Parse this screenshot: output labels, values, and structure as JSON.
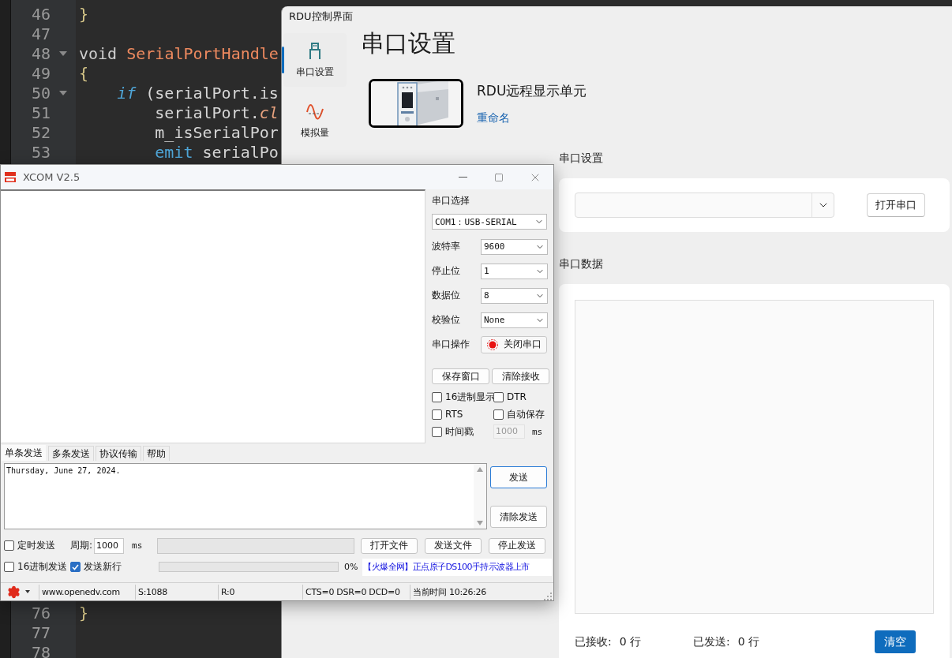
{
  "editor": {
    "lines_top": [
      {
        "number": "46",
        "fold": false,
        "tokens": [
          {
            "text": "}",
            "kind": "brace"
          }
        ]
      },
      {
        "number": "47",
        "fold": false
      },
      {
        "number": "48",
        "fold": true,
        "tokens": [
          {
            "text": "void",
            "kind": "type"
          },
          {
            "text": " SerialPortHandle",
            "kind": "function"
          }
        ]
      },
      {
        "number": "49",
        "fold": false,
        "tokens": [
          {
            "text": "{",
            "kind": "brace"
          }
        ]
      },
      {
        "number": "50",
        "fold": true,
        "tokens": [
          {
            "text": "    if",
            "kind": "keyword"
          },
          {
            "text": " (serialPort.is",
            "kind": "plain"
          }
        ]
      },
      {
        "number": "51",
        "fold": false,
        "tokens": [
          {
            "text": "        serialPort.",
            "kind": "plain"
          },
          {
            "text": "cl",
            "kind": "method"
          }
        ]
      },
      {
        "number": "52",
        "fold": false,
        "tokens": [
          {
            "text": "        m_isSerialPor",
            "kind": "plain"
          }
        ]
      },
      {
        "number": "53",
        "fold": false,
        "tokens": [
          {
            "text": "        emit",
            "kind": "keyword"
          },
          {
            "text": " serialPo",
            "kind": "plain"
          }
        ]
      }
    ],
    "lines_bottom": [
      {
        "number": "76",
        "fold": false,
        "tokens": [
          {
            "text": "}",
            "kind": "brace"
          }
        ]
      },
      {
        "number": "77",
        "fold": false
      },
      {
        "number": "78",
        "fold": false
      }
    ]
  },
  "rdu_window": {
    "title": "RDU控制界面",
    "nav": [
      {
        "label": "串口设置",
        "kind": "port",
        "selected": true
      },
      {
        "label": "模拟量",
        "kind": "wave",
        "selected": false
      }
    ],
    "heading": "串口设置",
    "device": {
      "kind": "picture",
      "name": "RDU远程显示单元",
      "rename_link": "重命名"
    },
    "port_section": {
      "label": "串口设置",
      "button": "打开串口"
    },
    "data_section": {
      "label": "串口数据",
      "received_label": "已接收:",
      "received": "0 行",
      "sent_label": "已发送:",
      "sent": "0 行",
      "clear_button": "清空"
    }
  },
  "xcom": {
    "title": "XCOM V2.5",
    "port_label": "串口选择",
    "port": "COM1：USB-SERIAL",
    "settings": [
      {
        "label": "波特率",
        "value": "9600"
      },
      {
        "label": "停止位",
        "value": "1"
      },
      {
        "label": "数据位",
        "value": "8"
      },
      {
        "label": "校验位",
        "value": "None"
      }
    ],
    "port_action": {
      "label": "串口操作",
      "button": "关闭串口",
      "open": true
    },
    "buttons": [
      "保存窗口",
      "清除接收"
    ],
    "options": [
      {
        "label": "16进制显示",
        "checked": false
      },
      {
        "label": "DTR",
        "checked": false
      },
      {
        "label": "RTS",
        "checked": false
      },
      {
        "label": "自动保存",
        "checked": false
      }
    ],
    "timestamp": {
      "label": "时间戳",
      "checked": false,
      "interval": "1000",
      "unit": "ms"
    },
    "tabs": [
      {
        "label": "单条发送",
        "selected": true
      },
      {
        "label": "多条发送",
        "selected": false
      },
      {
        "label": "协议传输",
        "selected": false
      },
      {
        "label": "帮助",
        "selected": false
      }
    ],
    "send_text": "Thursday, June 27, 2024.",
    "send_buttons": [
      "发送",
      "清除发送"
    ],
    "timed_send": {
      "label": "定时发送",
      "checked": false,
      "period_label": "周期:",
      "period": "1000",
      "unit": "ms",
      "level": 0
    },
    "file_buttons": [
      "打开文件",
      "发送文件",
      "停止发送"
    ],
    "hex_send": {
      "label": "16进制发送",
      "checked": false
    },
    "new_line": {
      "label": "发送新行",
      "checked": true
    },
    "send_progress": {
      "level": 0,
      "reading": "0%"
    },
    "ad_text": "【火爆全网】正点原子DS100手持示波器上市",
    "status_bar": [
      "www.openedv.com",
      "S:1088",
      "R:0",
      "CTS=0 DSR=0 DCD=0",
      "当前时间 10:26:26"
    ]
  }
}
